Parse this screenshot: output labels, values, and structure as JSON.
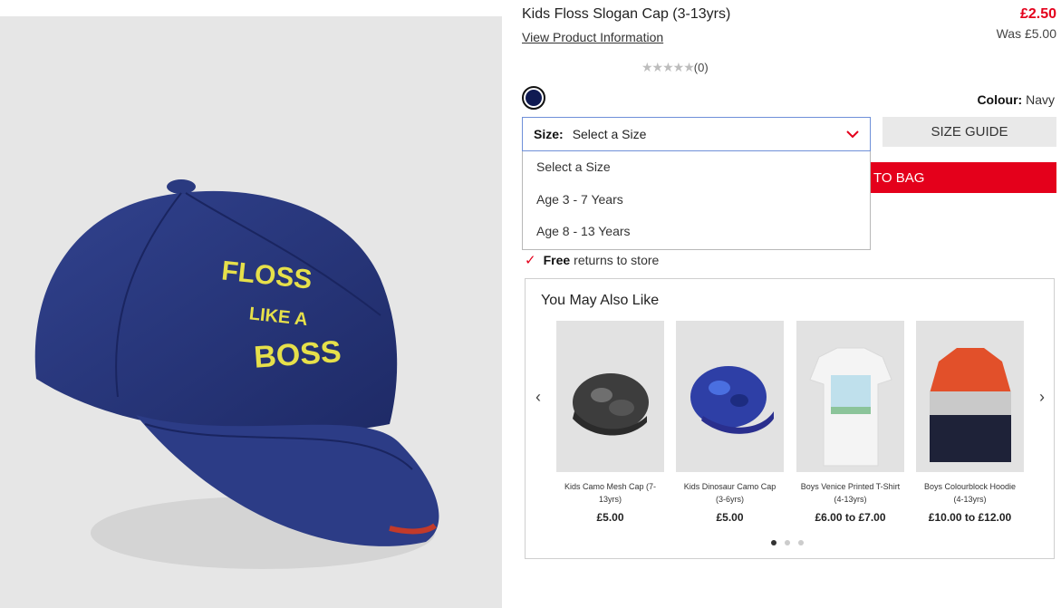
{
  "product": {
    "title": "Kids Floss Slogan Cap (3-13yrs)",
    "view_info": "View Product Information",
    "price": "£2.50",
    "was_price": "Was £5.00",
    "rating_count": "(0)",
    "stars": 5,
    "swatch_color": "#0f1a52",
    "colour_label": "Colour:",
    "colour_value": "Navy",
    "image_text": [
      "FLOSS",
      "LIKE A",
      "BOSS"
    ]
  },
  "size": {
    "label": "Size:",
    "selected": "Select a Size",
    "options": [
      "Select a Size",
      "Age 3 - 7 Years",
      "Age 8 - 13 Years"
    ]
  },
  "buttons": {
    "size_guide": "SIZE GUIDE",
    "add_to_bag": "TO BAG"
  },
  "returns": {
    "bold": "Free",
    "text": "returns to store"
  },
  "recommendations": {
    "heading": "You May Also Like",
    "items": [
      {
        "name": "Kids Camo Mesh Cap (7-13yrs)",
        "price": "£5.00"
      },
      {
        "name": "Kids Dinosaur Camo Cap (3-6yrs)",
        "price": "£5.00"
      },
      {
        "name": "Boys Venice Printed T-Shirt (4-13yrs)",
        "price": "£6.00 to £7.00"
      },
      {
        "name": "Boys Colourblock Hoodie (4-13yrs)",
        "price": "£10.00 to £12.00"
      }
    ],
    "page_count": 3,
    "active_page": 1
  },
  "colors": {
    "accent": "#e4001b",
    "navy": "#0f1a52"
  }
}
